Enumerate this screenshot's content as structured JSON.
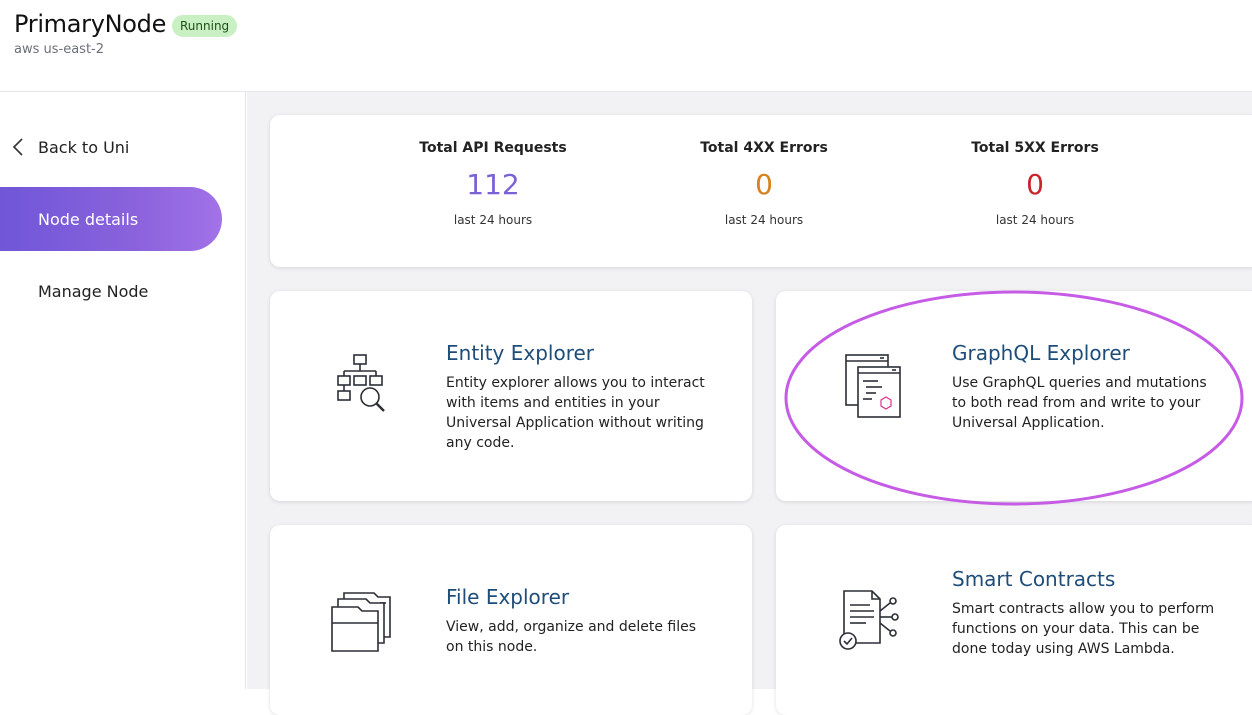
{
  "header": {
    "node_name": "PrimaryNode",
    "status": "Running",
    "region": "aws us-east-2"
  },
  "sidebar": {
    "back_label": "Back to Uni",
    "items": [
      {
        "label": "Node details",
        "active": true
      },
      {
        "label": "Manage Node",
        "active": false
      }
    ]
  },
  "stats": [
    {
      "label": "Total API Requests",
      "value": "112",
      "sub": "last 24 hours",
      "color": "#7b61d6"
    },
    {
      "label": "Total 4XX Errors",
      "value": "0",
      "sub": "last 24 hours",
      "color": "#d6821f"
    },
    {
      "label": "Total 5XX Errors",
      "value": "0",
      "sub": "last 24 hours",
      "color": "#c9262b"
    }
  ],
  "tiles": [
    {
      "title": "Entity Explorer",
      "description": "Entity explorer allows you to interact with items and entities in your Universal Application without writing any code.",
      "icon": "entity-explorer-icon"
    },
    {
      "title": "GraphQL Explorer",
      "description": "Use GraphQL queries and mutations to both read from and write to your Universal Application.",
      "icon": "graphql-explorer-icon"
    },
    {
      "title": "File Explorer",
      "description": "View, add, organize and delete files on this node.",
      "icon": "file-explorer-icon"
    },
    {
      "title": "Smart Contracts",
      "description": "Smart contracts allow you to perform functions on your data. This can be done today using AWS Lambda.",
      "icon": "smart-contracts-icon"
    }
  ],
  "colors": {
    "accent": "#7b61d6",
    "highlight": "#c65ce6",
    "tile_title": "#1e4d7a"
  }
}
